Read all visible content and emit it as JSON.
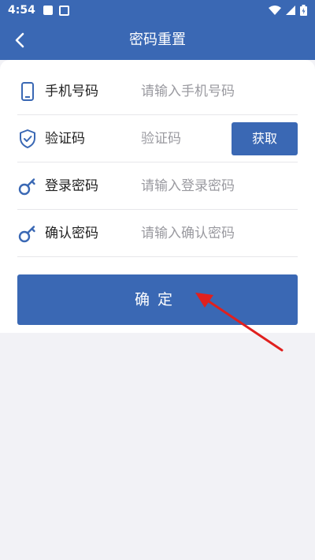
{
  "status_bar": {
    "time": "4:54"
  },
  "app_bar": {
    "title": "密码重置",
    "back_icon": "chevron-left-icon"
  },
  "form": {
    "rows": [
      {
        "label": "手机号码",
        "placeholder": "请输入手机号码",
        "icon": "phone-icon"
      },
      {
        "label": "验证码",
        "placeholder": "验证码",
        "icon": "shield-icon",
        "button": "获取"
      },
      {
        "label": "登录密码",
        "placeholder": "请输入登录密码",
        "icon": "key-icon"
      },
      {
        "label": "确认密码",
        "placeholder": "请输入确认密码",
        "icon": "key-icon"
      }
    ]
  },
  "confirm_button": {
    "label": "确定"
  },
  "colors": {
    "primary": "#3a68b4",
    "annotation_arrow": "#e0201e",
    "background": "#f2f2f6"
  }
}
